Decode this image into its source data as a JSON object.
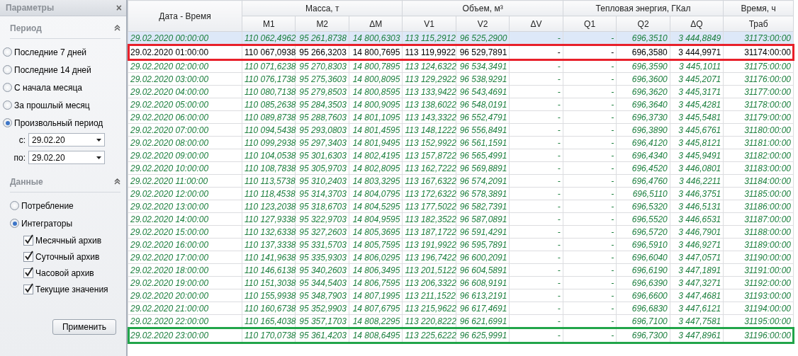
{
  "panel": {
    "title": "Параметры",
    "close": "×",
    "sections": [
      {
        "title": "Период",
        "expanded": true,
        "kind": "period",
        "options": [
          {
            "label": "Последние 7 дней",
            "selected": false
          },
          {
            "label": "Последние 14 дней",
            "selected": false
          },
          {
            "label": "С начала месяца",
            "selected": false
          },
          {
            "label": "За прошлый месяц",
            "selected": false
          },
          {
            "label": "Произвольный период",
            "selected": true
          }
        ],
        "dates": [
          {
            "label": "с:",
            "value": "29.02.20"
          },
          {
            "label": "по:",
            "value": "29.02.20"
          }
        ]
      },
      {
        "title": "Данные",
        "expanded": true,
        "kind": "data",
        "options": [
          {
            "label": "Потребление",
            "selected": false
          },
          {
            "label": "Интеграторы",
            "selected": true
          }
        ],
        "checkboxes": [
          {
            "label": "Месячный архив",
            "checked": true
          },
          {
            "label": "Суточный архив",
            "checked": true
          },
          {
            "label": "Часовой архив",
            "checked": true
          },
          {
            "label": "Текущие значения",
            "checked": true
          }
        ]
      }
    ],
    "apply_button": "Применить"
  },
  "table": {
    "date_column": "Дата - Время",
    "column_groups": [
      {
        "label": "Масса, т",
        "columns": [
          "M1",
          "M2",
          "ΔM"
        ]
      },
      {
        "label": "Объем, м³",
        "columns": [
          "V1",
          "V2",
          "ΔV"
        ]
      },
      {
        "label": "Тепловая энергия, ГКал",
        "columns": [
          "Q1",
          "Q2",
          "ΔQ"
        ]
      },
      {
        "label": "Время, ч",
        "columns": [
          "Траб"
        ]
      }
    ],
    "rows": [
      {
        "kind": "archive",
        "selected": true,
        "cells": [
          "29.02.2020 00:00:00",
          "110 062,4962",
          "95 261,8738",
          "14 800,6303",
          "113 115,2912",
          "96 525,2900",
          "-",
          "-",
          "696,3510",
          "3 444,8849",
          "31173:00:00"
        ]
      },
      {
        "kind": "current",
        "selected": false,
        "color": "#e8202a",
        "cells": [
          "29.02.2020 01:00:00",
          "110 067,0938",
          "95 266,3203",
          "14 800,7695",
          "113 119,9922",
          "96 529,7891",
          "-",
          "-",
          "696,3580",
          "3 444,9971",
          "31174:00:00"
        ]
      },
      {
        "kind": "archive",
        "selected": false,
        "cells": [
          "29.02.2020 02:00:00",
          "110 071,6238",
          "95 270,8303",
          "14 800,7895",
          "113 124,6322",
          "96 534,3491",
          "-",
          "-",
          "696,3590",
          "3 445,1011",
          "31175:00:00"
        ]
      },
      {
        "kind": "archive",
        "selected": false,
        "cells": [
          "29.02.2020 03:00:00",
          "110 076,1738",
          "95 275,3603",
          "14 800,8095",
          "113 129,2922",
          "96 538,9291",
          "-",
          "-",
          "696,3600",
          "3 445,2071",
          "31176:00:00"
        ]
      },
      {
        "kind": "archive",
        "selected": false,
        "cells": [
          "29.02.2020 04:00:00",
          "110 080,7138",
          "95 279,8503",
          "14 800,8595",
          "113 133,9422",
          "96 543,4691",
          "-",
          "-",
          "696,3620",
          "3 445,3171",
          "31177:00:00"
        ]
      },
      {
        "kind": "archive",
        "selected": false,
        "cells": [
          "29.02.2020 05:00:00",
          "110 085,2638",
          "95 284,3503",
          "14 800,9095",
          "113 138,6022",
          "96 548,0191",
          "-",
          "-",
          "696,3640",
          "3 445,4281",
          "31178:00:00"
        ]
      },
      {
        "kind": "archive",
        "selected": false,
        "cells": [
          "29.02.2020 06:00:00",
          "110 089,8738",
          "95 288,7603",
          "14 801,1095",
          "113 143,3322",
          "96 552,4791",
          "-",
          "-",
          "696,3730",
          "3 445,5481",
          "31179:00:00"
        ]
      },
      {
        "kind": "archive",
        "selected": false,
        "cells": [
          "29.02.2020 07:00:00",
          "110 094,5438",
          "95 293,0803",
          "14 801,4595",
          "113 148,1222",
          "96 556,8491",
          "-",
          "-",
          "696,3890",
          "3 445,6761",
          "31180:00:00"
        ]
      },
      {
        "kind": "archive",
        "selected": false,
        "cells": [
          "29.02.2020 08:00:00",
          "110 099,2938",
          "95 297,3403",
          "14 801,9495",
          "113 152,9922",
          "96 561,1591",
          "-",
          "-",
          "696,4120",
          "3 445,8121",
          "31181:00:00"
        ]
      },
      {
        "kind": "archive",
        "selected": false,
        "cells": [
          "29.02.2020 09:00:00",
          "110 104,0538",
          "95 301,6303",
          "14 802,4195",
          "113 157,8722",
          "96 565,4991",
          "-",
          "-",
          "696,4340",
          "3 445,9491",
          "31182:00:00"
        ]
      },
      {
        "kind": "archive",
        "selected": false,
        "cells": [
          "29.02.2020 10:00:00",
          "110 108,7838",
          "95 305,9703",
          "14 802,8095",
          "113 162,7222",
          "96 569,8891",
          "-",
          "-",
          "696,4520",
          "3 446,0801",
          "31183:00:00"
        ]
      },
      {
        "kind": "archive",
        "selected": false,
        "cells": [
          "29.02.2020 11:00:00",
          "110 113,5738",
          "95 310,2403",
          "14 803,3295",
          "113 167,6322",
          "96 574,2091",
          "-",
          "-",
          "696,4760",
          "3 446,2211",
          "31184:00:00"
        ]
      },
      {
        "kind": "archive",
        "selected": false,
        "cells": [
          "29.02.2020 12:00:00",
          "110 118,4538",
          "95 314,3703",
          "14 804,0795",
          "113 172,6322",
          "96 578,3891",
          "-",
          "-",
          "696,5110",
          "3 446,3751",
          "31185:00:00"
        ]
      },
      {
        "kind": "archive",
        "selected": false,
        "cells": [
          "29.02.2020 13:00:00",
          "110 123,2038",
          "95 318,6703",
          "14 804,5295",
          "113 177,5022",
          "96 582,7391",
          "-",
          "-",
          "696,5320",
          "3 446,5131",
          "31186:00:00"
        ]
      },
      {
        "kind": "archive",
        "selected": false,
        "cells": [
          "29.02.2020 14:00:00",
          "110 127,9338",
          "95 322,9703",
          "14 804,9595",
          "113 182,3522",
          "96 587,0891",
          "-",
          "-",
          "696,5520",
          "3 446,6531",
          "31187:00:00"
        ]
      },
      {
        "kind": "archive",
        "selected": false,
        "cells": [
          "29.02.2020 15:00:00",
          "110 132,6338",
          "95 327,2603",
          "14 805,3695",
          "113 187,1722",
          "96 591,4291",
          "-",
          "-",
          "696,5720",
          "3 446,7901",
          "31188:00:00"
        ]
      },
      {
        "kind": "archive",
        "selected": false,
        "cells": [
          "29.02.2020 16:00:00",
          "110 137,3338",
          "95 331,5703",
          "14 805,7595",
          "113 191,9922",
          "96 595,7891",
          "-",
          "-",
          "696,5910",
          "3 446,9271",
          "31189:00:00"
        ]
      },
      {
        "kind": "archive",
        "selected": false,
        "cells": [
          "29.02.2020 17:00:00",
          "110 141,9638",
          "95 335,9303",
          "14 806,0295",
          "113 196,7422",
          "96 600,2091",
          "-",
          "-",
          "696,6040",
          "3 447,0571",
          "31190:00:00"
        ]
      },
      {
        "kind": "archive",
        "selected": false,
        "cells": [
          "29.02.2020 18:00:00",
          "110 146,6138",
          "95 340,2603",
          "14 806,3495",
          "113 201,5122",
          "96 604,5891",
          "-",
          "-",
          "696,6190",
          "3 447,1891",
          "31191:00:00"
        ]
      },
      {
        "kind": "archive",
        "selected": false,
        "cells": [
          "29.02.2020 19:00:00",
          "110 151,3038",
          "95 344,5403",
          "14 806,7595",
          "113 206,3322",
          "96 608,9191",
          "-",
          "-",
          "696,6390",
          "3 447,3271",
          "31192:00:00"
        ]
      },
      {
        "kind": "archive",
        "selected": false,
        "cells": [
          "29.02.2020 20:00:00",
          "110 155,9938",
          "95 348,7903",
          "14 807,1995",
          "113 211,1522",
          "96 613,2191",
          "-",
          "-",
          "696,6600",
          "3 447,4681",
          "31193:00:00"
        ]
      },
      {
        "kind": "archive",
        "selected": false,
        "cells": [
          "29.02.2020 21:00:00",
          "110 160,6738",
          "95 352,9903",
          "14 807,6795",
          "113 215,9622",
          "96 617,4691",
          "-",
          "-",
          "696,6830",
          "3 447,6121",
          "31194:00:00"
        ]
      },
      {
        "kind": "archive",
        "selected": false,
        "cells": [
          "29.02.2020 22:00:00",
          "110 165,4038",
          "95 357,1703",
          "14 808,2295",
          "113 220,8222",
          "96 621,6991",
          "-",
          "-",
          "696,7100",
          "3 447,7581",
          "31195:00:00"
        ]
      },
      {
        "kind": "archive",
        "selected": false,
        "color": "#21a54a",
        "cells": [
          "29.02.2020 23:00:00",
          "110 170,0738",
          "95 361,4203",
          "14 808,6495",
          "113 225,6222",
          "96 625,9991",
          "-",
          "-",
          "696,7300",
          "3 447,8961",
          "31196:00:00"
        ]
      }
    ]
  }
}
